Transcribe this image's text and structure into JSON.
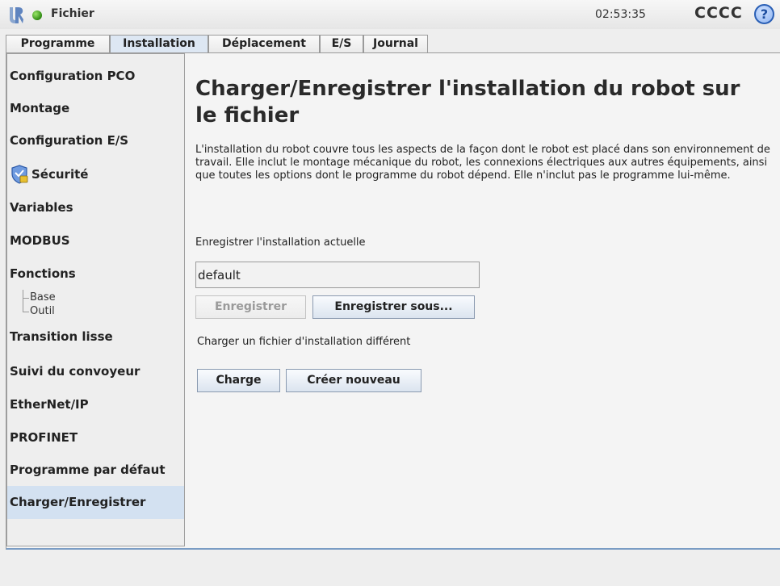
{
  "topbar": {
    "logo_icon": "ur-logo-icon",
    "status_color": "#3a9a1a",
    "file_menu_label": "Fichier",
    "time": "02:53:35",
    "robot_name": "CCCC",
    "help_label": "?"
  },
  "tabs": [
    {
      "label": "Programme",
      "active": false
    },
    {
      "label": "Installation",
      "active": true
    },
    {
      "label": "Déplacement",
      "active": false
    },
    {
      "label": "E/S",
      "active": false
    },
    {
      "label": "Journal",
      "active": false
    }
  ],
  "sidebar": {
    "items": [
      {
        "label": "Configuration PCO"
      },
      {
        "label": "Montage"
      },
      {
        "label": "Configuration E/S"
      },
      {
        "label": "Sécurité",
        "icon": "shield-icon"
      },
      {
        "label": "Variables"
      },
      {
        "label": "MODBUS"
      },
      {
        "label": "Fonctions",
        "children": [
          "Base",
          "Outil"
        ]
      },
      {
        "label": "Transition lisse"
      },
      {
        "label": "Suivi du convoyeur"
      },
      {
        "label": "EtherNet/IP"
      },
      {
        "label": "PROFINET"
      },
      {
        "label": "Programme par défaut"
      },
      {
        "label": "Charger/Enregistrer",
        "selected": true
      }
    ]
  },
  "main": {
    "title": "Charger/Enregistrer l'installation du robot sur le fichier",
    "description": "L'installation du robot couvre tous les aspects de la façon dont le robot est placé dans son environnement de travail. Elle inclut le montage mécanique du robot, les connexions électriques aux autres équipements, ainsi que toutes les options dont le programme du robot dépend. Elle n'inclut pas le programme lui-même.",
    "save_section_label": "Enregistrer l'installation actuelle",
    "installation_name": "default",
    "save_button": "Enregistrer",
    "save_as_button": "Enregistrer sous...",
    "load_section_label": "Charger un fichier d'installation différent",
    "load_button": "Charge",
    "create_new_button": "Créer nouveau"
  }
}
